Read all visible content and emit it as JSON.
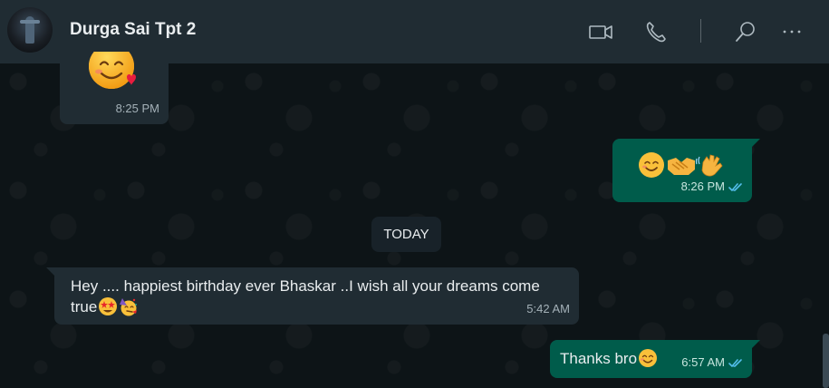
{
  "header": {
    "contact_name": "Durga Sai Tpt 2",
    "icons": [
      "video-call-icon",
      "voice-call-icon",
      "search-icon",
      "more-options-icon"
    ]
  },
  "colors": {
    "header_bg": "#202c33",
    "incoming_bubble": "#202c33",
    "outgoing_bubble": "#005c4b",
    "read_tick": "#53bdeb"
  },
  "messages": [
    {
      "direction": "incoming",
      "emoji": "smiling-face-with-hearts",
      "time": "8:25 PM"
    },
    {
      "direction": "outgoing",
      "emoji": [
        "smiling-face",
        "handshake",
        "waving-hand"
      ],
      "time": "8:26 PM",
      "status": "read"
    },
    {
      "direction": "incoming",
      "text": "Hey .... happiest birthday ever Bhaskar ..I wish all your dreams come true",
      "emoji": [
        "star-struck",
        "partying-face"
      ],
      "time": "5:42 AM"
    },
    {
      "direction": "outgoing",
      "text": "Thanks bro",
      "emoji": [
        "smiling-face"
      ],
      "time": "6:57 AM",
      "status": "read"
    }
  ],
  "date_separator": "TODAY"
}
